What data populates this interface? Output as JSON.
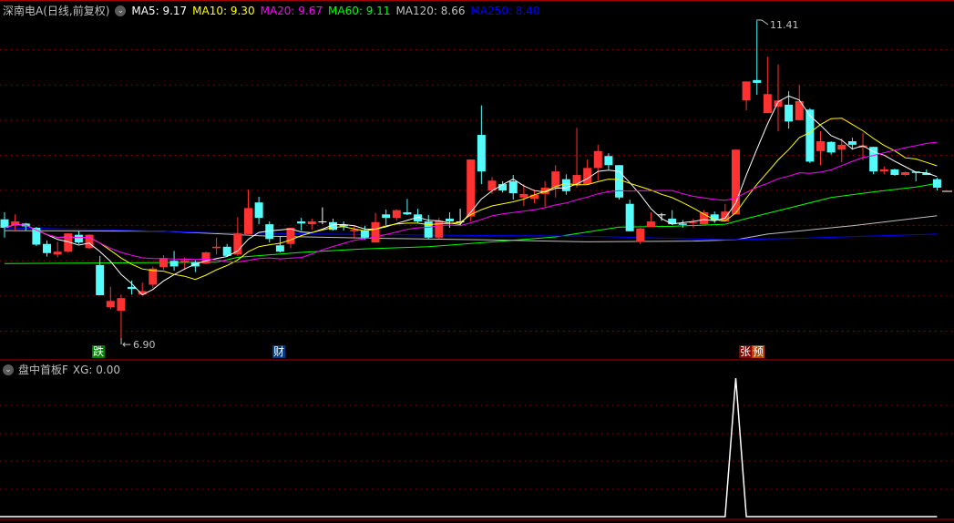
{
  "header": {
    "title": "深南电A(日线,前复权)",
    "ma5": "MA5: 9.17",
    "ma10": "MA10: 9.30",
    "ma20": "MA20: 9.67",
    "ma60": "MA60: 9.11",
    "ma120": "MA120: 8.66",
    "ma250": "MA250: 8.40"
  },
  "indicator": {
    "title": "盘中首板F",
    "xg": "XG: 0.00"
  },
  "markers": {
    "die": "跌",
    "cai": "财",
    "zhang": "张",
    "yu": "预"
  },
  "annotations": {
    "low": "6.90",
    "high": "11.41"
  },
  "colors": {
    "up": "#ff3232",
    "down": "#54fcfc",
    "ma5": "#ffffff",
    "ma10": "#ffff00",
    "ma20": "#ff00ff",
    "ma60": "#00ff00",
    "ma120": "#c0c0c0",
    "ma250": "#0000ff",
    "grid": "#a00000"
  },
  "chart_data": {
    "type": "candlestick",
    "price_range": [
      6.9,
      11.41
    ],
    "grid_prices": [
      11.0,
      10.5,
      10.0,
      9.5,
      9.0,
      8.5,
      8.0,
      7.5,
      7.0
    ],
    "ohlc": [
      [
        8.59,
        8.69,
        8.33,
        8.47
      ],
      [
        8.51,
        8.66,
        8.43,
        8.56
      ],
      [
        8.53,
        8.54,
        8.43,
        8.49
      ],
      [
        8.47,
        8.48,
        8.21,
        8.23
      ],
      [
        8.24,
        8.29,
        8.06,
        8.11
      ],
      [
        8.09,
        8.27,
        8.05,
        8.13
      ],
      [
        8.13,
        8.39,
        8.12,
        8.39
      ],
      [
        8.37,
        8.42,
        8.24,
        8.26
      ],
      [
        8.18,
        8.38,
        8.17,
        8.37
      ],
      [
        7.94,
        8.07,
        7.51,
        7.51
      ],
      [
        7.34,
        7.63,
        7.31,
        7.43
      ],
      [
        7.29,
        7.52,
        6.9,
        7.47
      ],
      [
        7.63,
        7.72,
        7.52,
        7.6
      ],
      [
        7.52,
        7.69,
        7.52,
        7.57
      ],
      [
        7.66,
        7.92,
        7.61,
        7.89
      ],
      [
        7.91,
        8.08,
        7.87,
        8.04
      ],
      [
        8.0,
        8.14,
        7.86,
        7.92
      ],
      [
        7.98,
        8.05,
        7.87,
        8.0
      ],
      [
        7.98,
        8.01,
        7.84,
        7.92
      ],
      [
        7.96,
        8.13,
        7.95,
        8.12
      ],
      [
        8.18,
        8.33,
        8.09,
        8.2
      ],
      [
        8.2,
        8.24,
        8.06,
        8.07
      ],
      [
        8.09,
        8.62,
        8.07,
        8.39
      ],
      [
        8.38,
        9.01,
        8.38,
        8.75
      ],
      [
        8.83,
        8.91,
        8.52,
        8.61
      ],
      [
        8.52,
        8.56,
        8.26,
        8.31
      ],
      [
        8.22,
        8.35,
        8.12,
        8.13
      ],
      [
        8.24,
        8.47,
        8.18,
        8.47
      ],
      [
        8.56,
        8.61,
        8.43,
        8.53
      ],
      [
        8.52,
        8.6,
        8.44,
        8.56
      ],
      [
        8.56,
        8.76,
        8.52,
        8.56
      ],
      [
        8.55,
        8.6,
        8.43,
        8.44
      ],
      [
        8.51,
        8.56,
        8.43,
        8.49
      ],
      [
        8.42,
        8.5,
        8.33,
        8.44
      ],
      [
        8.43,
        8.5,
        8.3,
        8.33
      ],
      [
        8.26,
        8.68,
        8.26,
        8.55
      ],
      [
        8.66,
        8.73,
        8.51,
        8.61
      ],
      [
        8.61,
        8.73,
        8.57,
        8.72
      ],
      [
        8.69,
        8.88,
        8.65,
        8.66
      ],
      [
        8.66,
        8.74,
        8.53,
        8.56
      ],
      [
        8.56,
        8.65,
        8.31,
        8.33
      ],
      [
        8.33,
        8.61,
        8.31,
        8.57
      ],
      [
        8.6,
        8.69,
        8.47,
        8.56
      ],
      [
        8.56,
        8.74,
        8.51,
        8.56
      ],
      [
        8.63,
        9.44,
        8.56,
        9.44
      ],
      [
        9.79,
        10.21,
        9.09,
        9.27
      ],
      [
        9.0,
        9.19,
        8.95,
        9.14
      ],
      [
        9.09,
        9.13,
        8.97,
        9.0
      ],
      [
        9.13,
        9.22,
        8.87,
        8.96
      ],
      [
        8.9,
        9.09,
        8.78,
        8.95
      ],
      [
        8.88,
        9.01,
        8.82,
        8.94
      ],
      [
        8.95,
        9.13,
        8.77,
        9.04
      ],
      [
        9.04,
        9.36,
        8.9,
        9.27
      ],
      [
        9.16,
        9.23,
        8.94,
        8.99
      ],
      [
        9.08,
        9.89,
        9.04,
        9.22
      ],
      [
        9.09,
        9.44,
        9.09,
        9.32
      ],
      [
        9.32,
        9.65,
        9.14,
        9.56
      ],
      [
        9.49,
        9.53,
        9.3,
        9.36
      ],
      [
        9.36,
        9.36,
        8.87,
        8.9
      ],
      [
        8.81,
        8.87,
        8.42,
        8.42
      ],
      [
        8.27,
        8.47,
        8.24,
        8.46
      ],
      [
        8.48,
        8.69,
        8.48,
        8.56
      ],
      [
        8.66,
        8.68,
        8.57,
        8.66
      ],
      [
        8.6,
        8.72,
        8.51,
        8.52
      ],
      [
        8.53,
        8.58,
        8.47,
        8.51
      ],
      [
        8.54,
        8.6,
        8.47,
        8.55
      ],
      [
        8.52,
        8.72,
        8.52,
        8.69
      ],
      [
        8.66,
        8.7,
        8.54,
        8.58
      ],
      [
        8.56,
        8.81,
        8.56,
        8.7
      ],
      [
        8.66,
        9.58,
        8.66,
        9.58
      ],
      [
        10.28,
        10.55,
        10.14,
        10.55
      ],
      [
        10.57,
        11.41,
        10.36,
        10.53
      ],
      [
        10.1,
        10.9,
        10.1,
        10.37
      ],
      [
        10.19,
        10.79,
        9.84,
        10.28
      ],
      [
        10.22,
        10.41,
        9.88,
        9.98
      ],
      [
        10.0,
        10.5,
        10.0,
        10.27
      ],
      [
        10.15,
        10.17,
        9.39,
        9.41
      ],
      [
        9.56,
        9.84,
        9.36,
        9.7
      ],
      [
        9.69,
        9.7,
        9.51,
        9.54
      ],
      [
        9.58,
        9.74,
        9.4,
        9.65
      ],
      [
        9.7,
        9.75,
        9.58,
        9.65
      ],
      [
        9.61,
        9.82,
        9.43,
        9.64
      ],
      [
        9.62,
        9.62,
        9.23,
        9.27
      ],
      [
        9.27,
        9.34,
        9.23,
        9.3
      ],
      [
        9.3,
        9.31,
        9.21,
        9.22
      ],
      [
        9.22,
        9.27,
        9.21,
        9.26
      ],
      [
        9.27,
        9.27,
        9.13,
        9.25
      ],
      [
        9.25,
        9.3,
        9.22,
        9.22
      ],
      [
        9.16,
        9.18,
        9.0,
        9.04
      ]
    ],
    "ma_computed": [
      {
        "name": "MA5",
        "period": 5
      },
      {
        "name": "MA10",
        "period": 10
      },
      {
        "name": "MA20",
        "period": 20
      }
    ],
    "ma_long": [
      {
        "name": "MA60",
        "points": [
          [
            0,
            7.96
          ],
          [
            20,
            7.98
          ],
          [
            22,
            8.05
          ],
          [
            28,
            8.12
          ],
          [
            34,
            8.17
          ],
          [
            40,
            8.2
          ],
          [
            47,
            8.28
          ],
          [
            52,
            8.34
          ],
          [
            58,
            8.48
          ],
          [
            63,
            8.49
          ],
          [
            68,
            8.52
          ],
          [
            70,
            8.6
          ],
          [
            74,
            8.75
          ],
          [
            78,
            8.9
          ],
          [
            82,
            8.98
          ],
          [
            86,
            9.05
          ],
          [
            88,
            9.1
          ]
        ]
      },
      {
        "name": "MA120",
        "points": [
          [
            0,
            8.43
          ],
          [
            15,
            8.42
          ],
          [
            25,
            8.35
          ],
          [
            35,
            8.32
          ],
          [
            45,
            8.3
          ],
          [
            55,
            8.27
          ],
          [
            65,
            8.28
          ],
          [
            69,
            8.3
          ],
          [
            72,
            8.38
          ],
          [
            80,
            8.5
          ],
          [
            88,
            8.64
          ]
        ]
      },
      {
        "name": "MA250",
        "points": [
          [
            0,
            8.47
          ],
          [
            10,
            8.44
          ],
          [
            20,
            8.4
          ],
          [
            30,
            8.38
          ],
          [
            45,
            8.36
          ],
          [
            55,
            8.35
          ],
          [
            60,
            8.33
          ],
          [
            68,
            8.3
          ],
          [
            75,
            8.32
          ],
          [
            88,
            8.38
          ]
        ]
      }
    ],
    "xg_signal_index": 69,
    "xg_range": [
      0,
      1
    ]
  }
}
